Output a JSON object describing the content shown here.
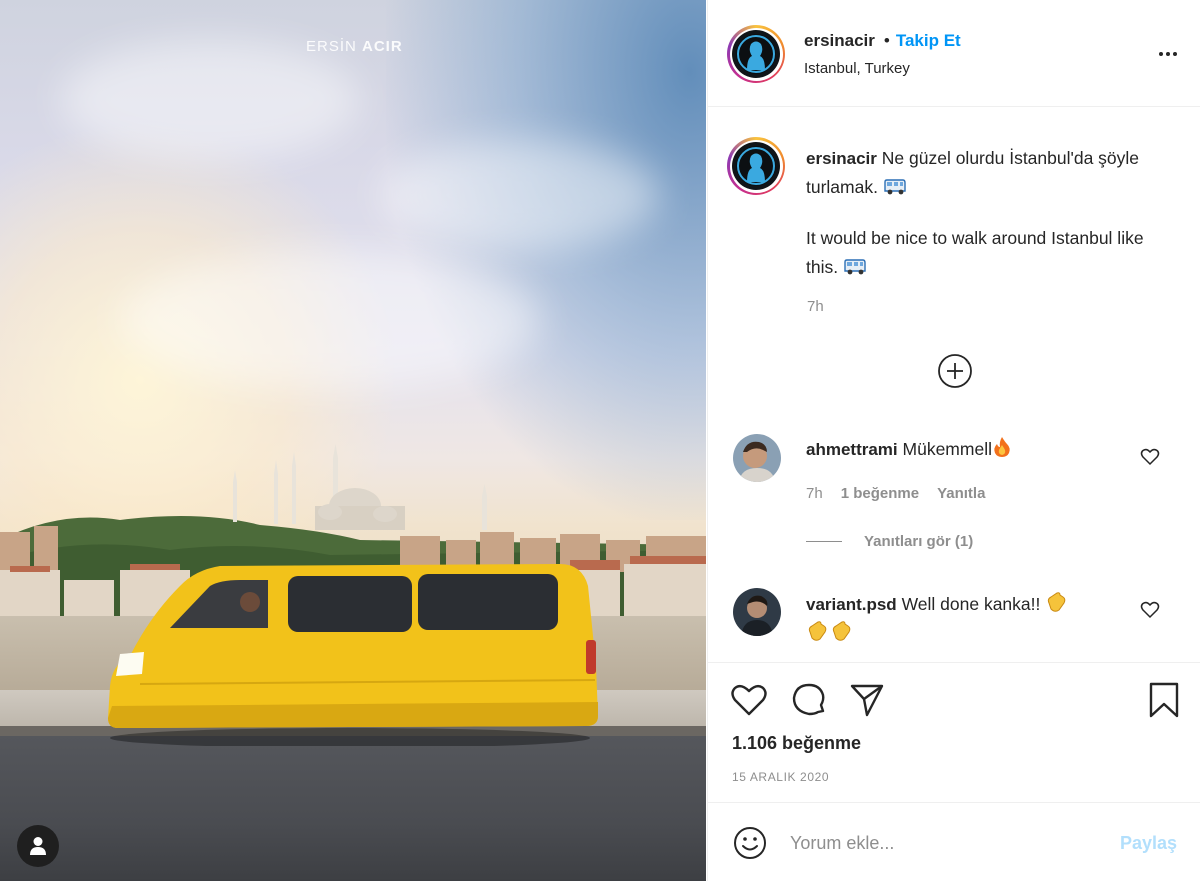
{
  "photo": {
    "watermark_first": "ERSİN",
    "watermark_last": "ACIR",
    "tag_icon": "user-icon"
  },
  "header": {
    "username": "ersinacir",
    "separator": "•",
    "follow_label": "Takip Et",
    "location": "Istanbul, Turkey",
    "more_icon": "more-dots-icon"
  },
  "caption": {
    "username": "ersinacir",
    "line1": "Ne güzel olurdu İstanbul'da şöyle turlamak.",
    "line2": "It would be nice to walk around Istanbul like this.",
    "emoji": "van-emoji",
    "time": "7h"
  },
  "load_more_icon": "plus-circle-icon",
  "comments": [
    {
      "username": "ahmettrami",
      "text": "Mükemmell",
      "emoji": "fire-emoji",
      "time": "7h",
      "likes": "1 beğenme",
      "reply": "Yanıtla",
      "view_replies": "Yanıtları gör (1)"
    },
    {
      "username": "variant.psd",
      "text": "Well done kanka!!",
      "emoji": "clapping-hands-emoji"
    }
  ],
  "actions": {
    "like_icon": "heart-icon",
    "comment_icon": "comment-icon",
    "share_icon": "send-icon",
    "save_icon": "bookmark-icon",
    "likes": "1.106 beğenme",
    "date": "15 ARALIK 2020"
  },
  "composer": {
    "placeholder": "Yorum ekle...",
    "post_label": "Paylaş",
    "emoji_icon": "smiley-icon"
  },
  "colors": {
    "link_blue": "#0095f6",
    "post_disabled": "#b2dffc",
    "text_primary": "#262626",
    "text_secondary": "#8e8e8e",
    "van_yellow": "#f2c21a"
  }
}
